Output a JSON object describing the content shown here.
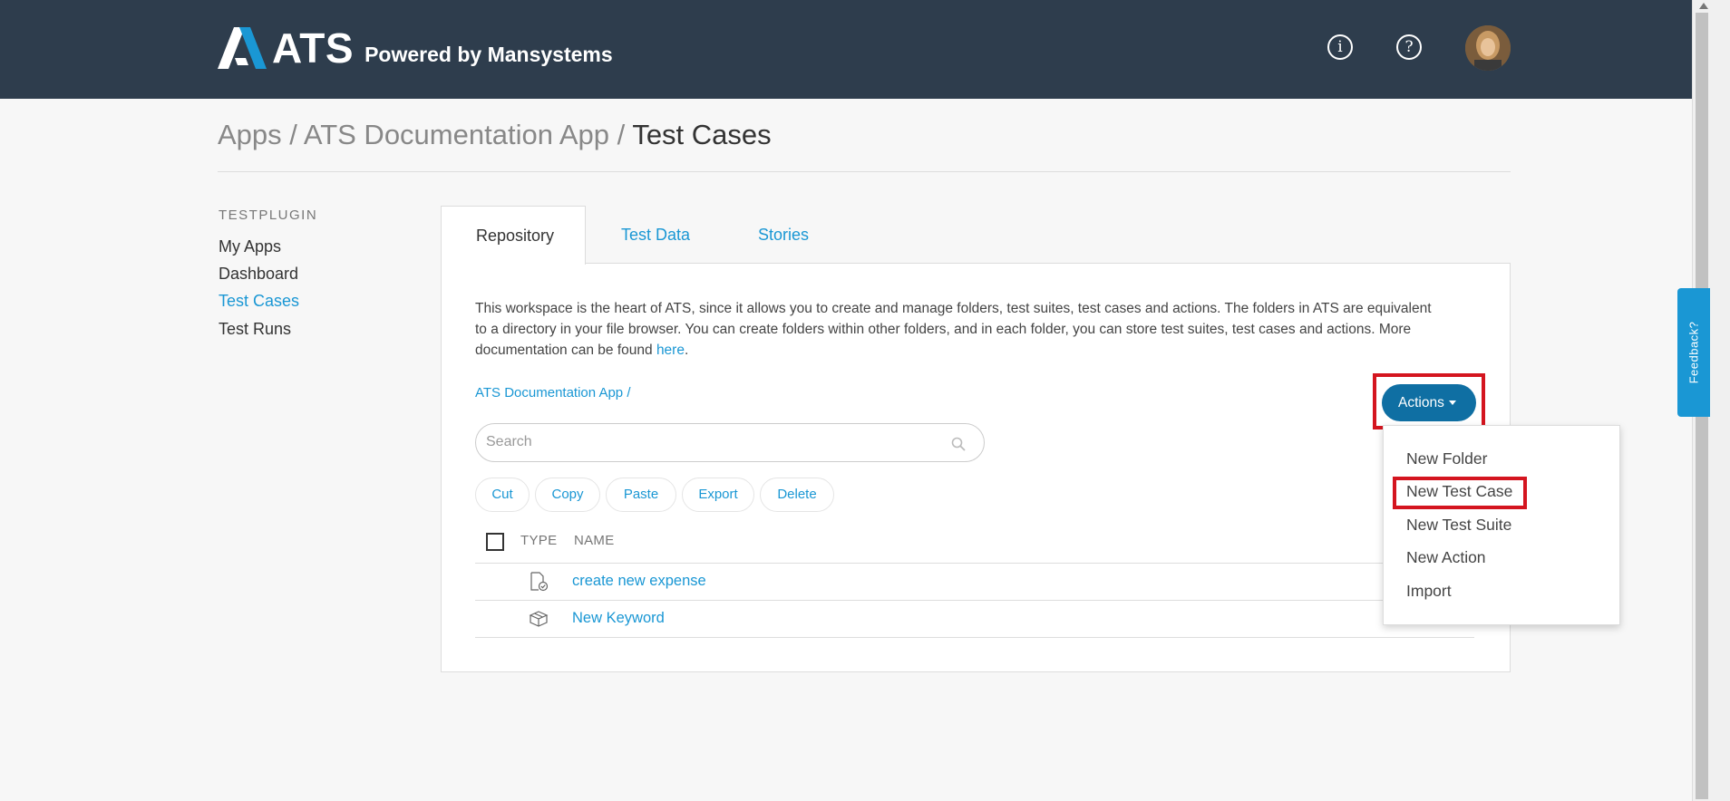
{
  "header": {
    "logo_text": "ATS",
    "powered_by": "Powered by Mansystems",
    "info_icon": "info-icon",
    "help_icon": "help-icon",
    "info_glyph": "i",
    "help_glyph": "?"
  },
  "breadcrumb": {
    "apps": "Apps",
    "sep1": "/",
    "app": "ATS Documentation App",
    "sep2": "/",
    "current": "Test Cases"
  },
  "sidebar": {
    "heading": "TESTPLUGIN",
    "items": [
      {
        "label": "My Apps"
      },
      {
        "label": "Dashboard"
      },
      {
        "label": "Test Cases"
      },
      {
        "label": "Test Runs"
      }
    ]
  },
  "tabs": [
    {
      "label": "Repository"
    },
    {
      "label": "Test Data"
    },
    {
      "label": "Stories"
    }
  ],
  "description": {
    "text": "This workspace is the heart of ATS, since it allows you to create and manage folders, test suites, test cases and actions. The folders in ATS are equivalent to a directory in your file browser. You can create folders within other folders, and in each folder, you can store test suites, test cases and actions. More documentation can be found ",
    "link": "here",
    "end": "."
  },
  "path_link": "ATS Documentation App /",
  "search": {
    "placeholder": "Search",
    "value": ""
  },
  "toolbar": {
    "cut": "Cut",
    "copy": "Copy",
    "paste": "Paste",
    "export": "Export",
    "delete": "Delete"
  },
  "table": {
    "columns": [
      "TYPE",
      "NAME"
    ],
    "rows": [
      {
        "type_icon": "test-case-icon",
        "name": "create new expense"
      },
      {
        "type_icon": "keyword-box-icon",
        "name": "New Keyword"
      }
    ]
  },
  "actions": {
    "label": "Actions",
    "menu": [
      {
        "label": "New Folder"
      },
      {
        "label": "New Test Case"
      },
      {
        "label": "New Test Suite"
      },
      {
        "label": "New Action"
      },
      {
        "label": "Import"
      }
    ]
  },
  "feedback": "Feedback?",
  "colors": {
    "header_bg": "#2e3d4d",
    "accent": "#1a97d4",
    "actions_button": "#0f6fa3",
    "highlight": "#d4151f"
  }
}
